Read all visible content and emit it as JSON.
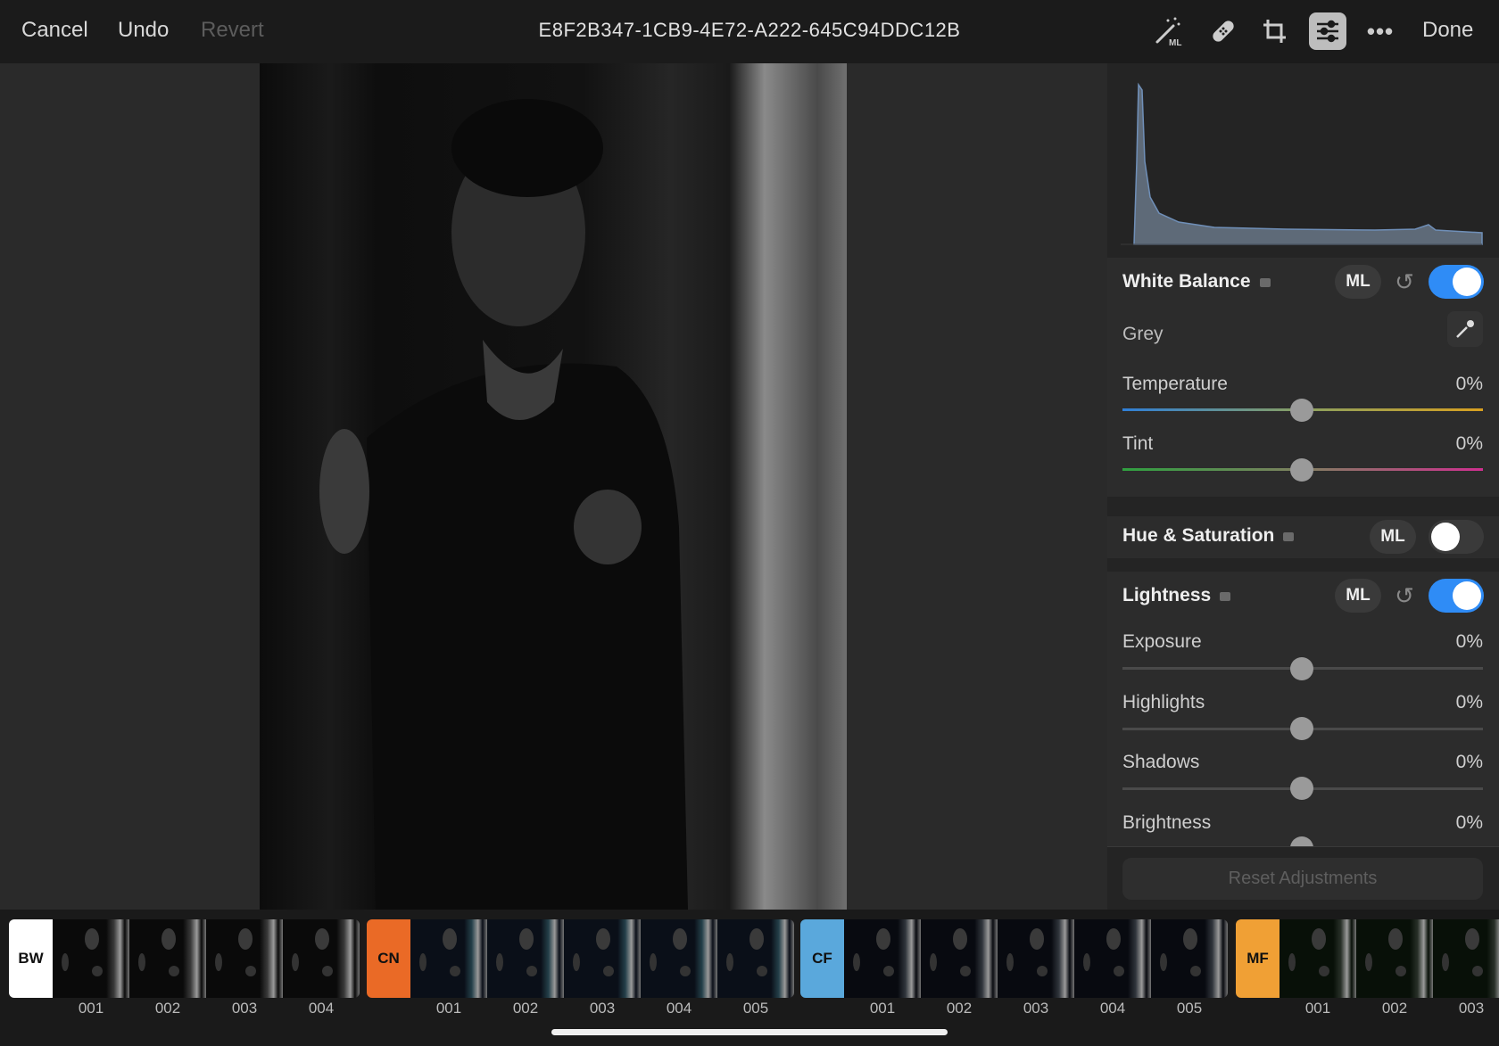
{
  "topbar": {
    "cancel": "Cancel",
    "undo": "Undo",
    "revert": "Revert",
    "title": "E8F2B347-1CB9-4E72-A222-645C94DDC12B",
    "done": "Done",
    "icons": [
      "magic-wand-ml-icon",
      "bandage-icon",
      "crop-icon",
      "adjustments-sliders-icon",
      "more-icon"
    ],
    "ml_badge": "ML"
  },
  "panel": {
    "white_balance": {
      "title": "White Balance",
      "ml": "ML",
      "enabled": true,
      "grey_label": "Grey",
      "sliders": [
        {
          "label": "Temperature",
          "value": "0%"
        },
        {
          "label": "Tint",
          "value": "0%"
        }
      ]
    },
    "hue_saturation": {
      "title": "Hue & Saturation",
      "ml": "ML",
      "enabled": false
    },
    "lightness": {
      "title": "Lightness",
      "ml": "ML",
      "enabled": true,
      "sliders": [
        {
          "label": "Exposure",
          "value": "0%"
        },
        {
          "label": "Highlights",
          "value": "0%"
        },
        {
          "label": "Shadows",
          "value": "0%"
        },
        {
          "label": "Brightness",
          "value": "0%"
        }
      ]
    },
    "reset": "Reset Adjustments",
    "accent": "#2f8cf6"
  },
  "filmstrip": {
    "groups": [
      {
        "code": "BW",
        "color": "#ffffff",
        "items": [
          "001",
          "002",
          "003",
          "004"
        ]
      },
      {
        "code": "CN",
        "color": "#ea6a26",
        "items": [
          "001",
          "002",
          "003",
          "004",
          "005"
        ]
      },
      {
        "code": "CF",
        "color": "#5aa8dc",
        "items": [
          "001",
          "002",
          "003",
          "004",
          "005"
        ]
      },
      {
        "code": "MF",
        "color": "#f0a035",
        "items": [
          "001",
          "002",
          "003"
        ]
      }
    ]
  }
}
